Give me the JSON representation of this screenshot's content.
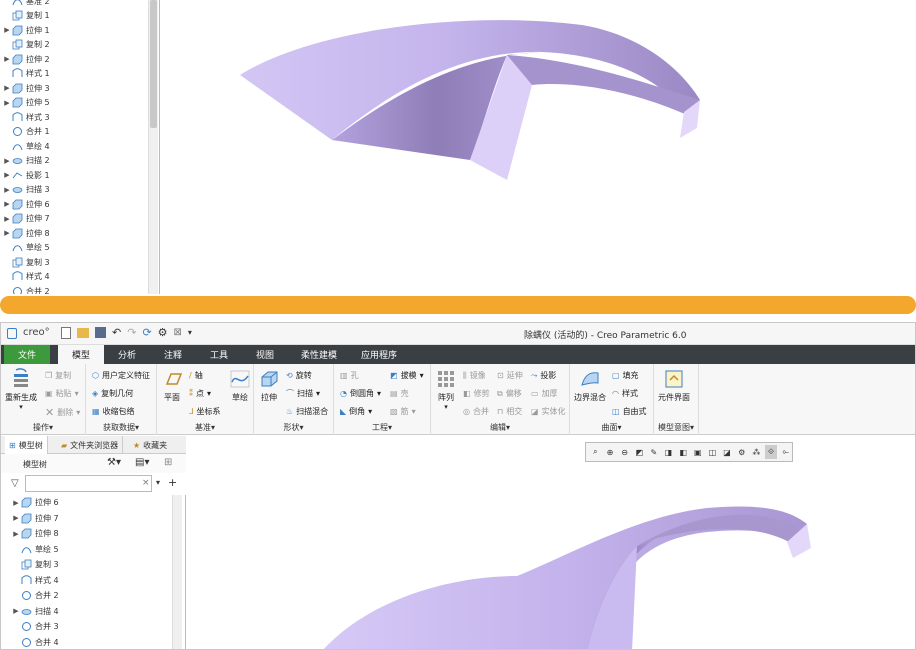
{
  "top_tree": {
    "rows": [
      {
        "label": "基准 2",
        "icon": "sketch-icon",
        "expand": false
      },
      {
        "label": "复制 1",
        "icon": "copy-icon",
        "expand": false
      },
      {
        "label": "拉伸 1",
        "icon": "extrude-icon",
        "expand": true
      },
      {
        "label": "复制 2",
        "icon": "copy-icon",
        "expand": false
      },
      {
        "label": "拉伸 2",
        "icon": "extrude-icon",
        "expand": true
      },
      {
        "label": "样式 1",
        "icon": "style-icon",
        "expand": false
      },
      {
        "label": "拉伸 3",
        "icon": "extrude-icon",
        "expand": true
      },
      {
        "label": "拉伸 5",
        "icon": "extrude-icon",
        "expand": true
      },
      {
        "label": "样式 3",
        "icon": "style-icon",
        "expand": false
      },
      {
        "label": "合并 1",
        "icon": "merge-icon",
        "expand": false
      },
      {
        "label": "草绘 4",
        "icon": "sketch-icon",
        "expand": false
      },
      {
        "label": "扫描 2",
        "icon": "sweep-icon",
        "expand": true
      },
      {
        "label": "投影 1",
        "icon": "project-icon",
        "expand": true
      },
      {
        "label": "扫描 3",
        "icon": "sweep-icon",
        "expand": true
      },
      {
        "label": "拉伸 6",
        "icon": "extrude-icon",
        "expand": true
      },
      {
        "label": "拉伸 7",
        "icon": "extrude-icon",
        "expand": true
      },
      {
        "label": "拉伸 8",
        "icon": "extrude-icon",
        "expand": true
      },
      {
        "label": "草绘 5",
        "icon": "sketch-icon",
        "expand": false
      },
      {
        "label": "复制 3",
        "icon": "copy-icon",
        "expand": false
      },
      {
        "label": "样式 4",
        "icon": "style-icon",
        "expand": false
      },
      {
        "label": "合并 2",
        "icon": "merge-icon",
        "expand": false
      }
    ]
  },
  "app": {
    "logo": "creo°",
    "title": "除螨仪 (活动的) - Creo Parametric 6.0",
    "menu": [
      {
        "label": "文件",
        "active": false,
        "file": true
      },
      {
        "label": "模型",
        "active": true
      },
      {
        "label": "分析"
      },
      {
        "label": "注释"
      },
      {
        "label": "工具"
      },
      {
        "label": "视图"
      },
      {
        "label": "柔性建模"
      },
      {
        "label": "应用程序"
      }
    ],
    "ribbon": {
      "regen": "重新生成",
      "copy": "复制",
      "paste": "粘贴",
      "delete": "删除",
      "op_group": "操作",
      "udf": "用户定义特征",
      "copy_geom": "复制几何",
      "shrinkwrap": "收缩包络",
      "getdata_group": "获取数据",
      "plane": "平面",
      "axis": "轴",
      "point": "点",
      "csys": "坐标系",
      "sketch": "草绘",
      "datum_group": "基准",
      "extrude": "拉伸",
      "revolve": "旋转",
      "sweep": "扫描",
      "swept_blend": "扫描混合",
      "shape_group": "形状",
      "hole": "孔",
      "round": "倒圆角",
      "chamfer": "倒角",
      "draft": "拔模",
      "shell": "壳",
      "rib": "筋",
      "eng_group": "工程",
      "pattern": "阵列",
      "mirror": "镜像",
      "extend": "延伸",
      "project": "投影",
      "trim": "修剪",
      "offset": "偏移",
      "thicken": "加厚",
      "merge": "合并",
      "intersect": "相交",
      "solidify": "实体化",
      "edit_group": "编辑",
      "boundary_blend": "边界混合",
      "fill": "填充",
      "style": "样式",
      "freestyle": "自由式",
      "surface_group": "曲面",
      "component_interface": "元件界面",
      "intent_group": "模型意图"
    },
    "nav_tabs": [
      "模型树",
      "文件夹浏览器",
      "收藏夹"
    ],
    "tree_title": "模型树",
    "filter_placeholder": "",
    "tree_rows": [
      {
        "label": "拉伸 6",
        "icon": "extrude-icon",
        "expand": true
      },
      {
        "label": "拉伸 7",
        "icon": "extrude-icon",
        "expand": true
      },
      {
        "label": "拉伸 8",
        "icon": "extrude-icon",
        "expand": true
      },
      {
        "label": "草绘 5",
        "icon": "sketch-icon",
        "expand": false
      },
      {
        "label": "复制 3",
        "icon": "copy-icon",
        "expand": false
      },
      {
        "label": "样式 4",
        "icon": "style-icon",
        "expand": false
      },
      {
        "label": "合并 2",
        "icon": "merge-icon",
        "expand": false
      },
      {
        "label": "扫描 4",
        "icon": "sweep-icon",
        "expand": true
      },
      {
        "label": "合并 3",
        "icon": "merge-icon",
        "expand": false
      },
      {
        "label": "合并 4",
        "icon": "merge-icon",
        "expand": false
      }
    ]
  },
  "colors": {
    "accent_bar": "#f3a72c",
    "menubar": "#3a3f44",
    "file_tab": "#3c9a3c",
    "surface": "#c7b6ec"
  }
}
